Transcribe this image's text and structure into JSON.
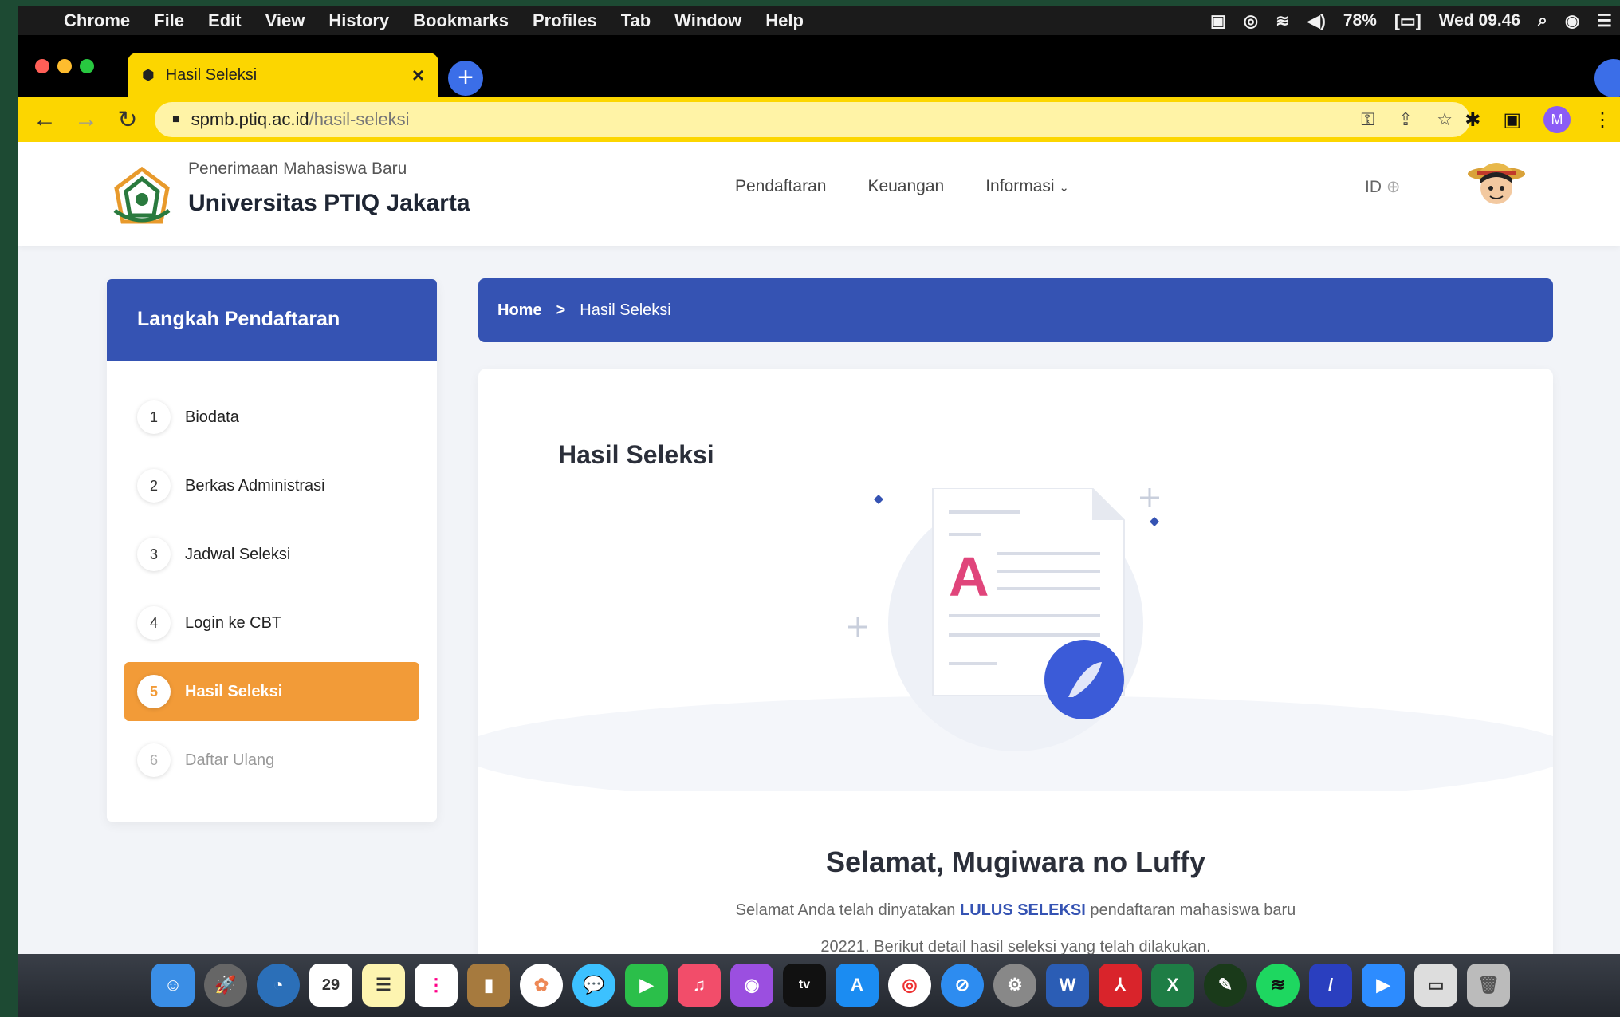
{
  "menubar": {
    "app": "Chrome",
    "items": [
      "File",
      "Edit",
      "View",
      "History",
      "Bookmarks",
      "Profiles",
      "Tab",
      "Window",
      "Help"
    ],
    "battery": "78%",
    "clock": "Wed 09.46"
  },
  "browser": {
    "tab_title": "Hasil Seleksi",
    "tab_close": "×",
    "new_tab": "+",
    "url_domain": "spmb.ptiq.ac.id",
    "url_path": "/hasil-seleksi",
    "profile_initial": "M"
  },
  "site": {
    "subtitle": "Penerimaan Mahasiswa Baru",
    "title": "Universitas PTIQ Jakarta",
    "nav": [
      "Pendaftaran",
      "Keuangan",
      "Informasi"
    ],
    "lang": "ID"
  },
  "sidebar": {
    "title": "Langkah Pendaftaran",
    "steps": [
      {
        "num": "1",
        "label": "Biodata"
      },
      {
        "num": "2",
        "label": "Berkas Administrasi"
      },
      {
        "num": "3",
        "label": "Jadwal Seleksi"
      },
      {
        "num": "4",
        "label": "Login ke CBT"
      },
      {
        "num": "5",
        "label": "Hasil Seleksi"
      },
      {
        "num": "6",
        "label": "Daftar Ulang"
      }
    ]
  },
  "breadcrumb": {
    "home": "Home",
    "separator": ">",
    "current": "Hasil Seleksi"
  },
  "main": {
    "title": "Hasil Seleksi",
    "illustration_letter": "A",
    "greeting": "Selamat,",
    "name": "Mugiwara no Luffy",
    "result_prefix": "Selamat Anda telah dinyatakan",
    "result_status": "LULUS SELEKSI",
    "result_suffix": "pendaftaran mahasiswa baru",
    "result_line2": "20221. Berikut detail hasil seleksi yang telah dilakukan."
  },
  "dock": {
    "calendar_day": "29",
    "apps": [
      "finder",
      "launchpad",
      "browser",
      "calendar",
      "notes",
      "reminders",
      "notebook",
      "photos",
      "messages",
      "facetime",
      "music",
      "podcasts",
      "tv",
      "app-store",
      "chrome",
      "safari",
      "system-preferences",
      "word",
      "acrobat",
      "excel",
      "pen-tool",
      "spotify",
      "pen",
      "zoom",
      "preview",
      "trash"
    ],
    "word_label": "W",
    "excel_label": "X",
    "tv_label": "tv"
  },
  "colors": {
    "primary": "#3553b3",
    "accent": "#f29b38",
    "chrome_yellow": "#fcd600"
  }
}
